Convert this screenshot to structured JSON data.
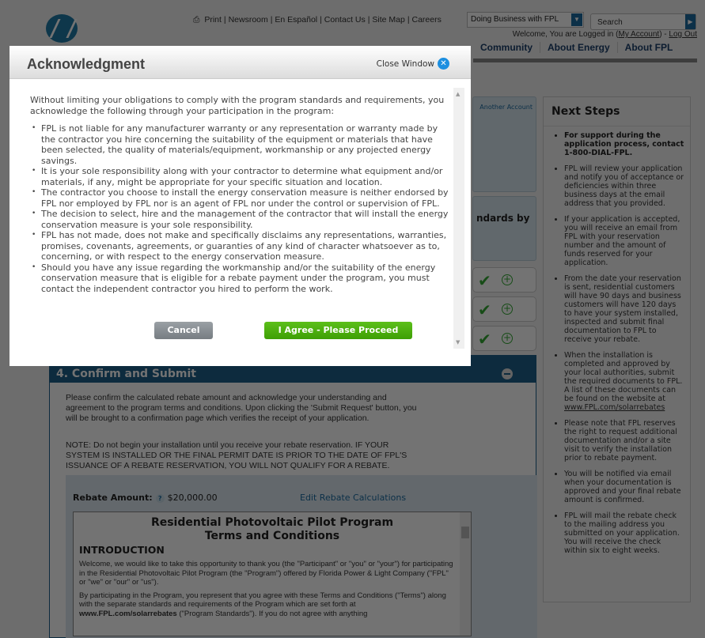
{
  "header": {
    "links": [
      "Print",
      "Newsroom",
      "En Español",
      "Contact Us",
      "Site Map",
      "Careers"
    ],
    "business_select": "Doing Business with FPL",
    "search_placeholder": "Search",
    "welcome": "Welcome, You are Logged in (",
    "my_account": "My Account",
    "sep": ") - ",
    "logout": "Log Out",
    "nav": [
      "Community",
      "About Energy",
      "About FPL"
    ]
  },
  "steps": {
    "another_account": "Another Account",
    "standards_by": "ndards by",
    "step4_title": "4. Confirm and Submit"
  },
  "confirm": {
    "paragraph": "Please confirm the calculated rebate amount and acknowledge your understanding and agreement to the program terms and conditions. Upon clicking the 'Submit Request' button, you will be brought to a confirmation page which verifies the receipt of your application.",
    "note": "NOTE: Do not begin your installation until you receive your rebate reservation. IF YOUR SYSTEM IS INSTALLED OR THE FINAL PERMIT DATE IS PRIOR TO THE DATE OF FPL'S ISSUANCE OF A REBATE RESERVATION, YOU WILL NOT QUALIFY FOR A REBATE.",
    "rebate_label": "Rebate Amount:",
    "help": "?",
    "rebate_amount": "$20,000.00",
    "edit_link": "Edit Rebate Calculations"
  },
  "terms": {
    "title1": "Residential Photovoltaic Pilot Program",
    "title2": "Terms and Conditions",
    "intro": "INTRODUCTION",
    "p1": "Welcome, we would like to take this opportunity to thank you (the \"Participant\" or \"you\" or \"your\") for participating in the Residential Photovoltaic Pilot Program (the \"Program\") offered by Florida Power & Light Company (\"FPL\" or \"we\" or \"our\" or \"us\").",
    "p2a": "By participating in the Program, you represent that you agree with these Terms and Conditions (\"Terms\") along with the separate standards and requirements of the Program which are set forth at ",
    "p2link": "www.FPL.com/solarrebates",
    "p2b": " (\"Program Standards\"). If you do not agree with anything"
  },
  "sidebar": {
    "title": "Next Steps",
    "items": [
      "For support during the application process, contact 1-800-DIAL-FPL.",
      "FPL will review your application and notify you of acceptance or deficiencies within three business days at the email address that you provided.",
      "If your application is accepted, you will receive an email from FPL with your reservation number and the amount of funds reserved for your application.",
      "From the date your reservation is sent, residential customers will have 90 days and business customers will have 120 days to have your system installed, inspected and submit final documentation to FPL to receive your rebate.",
      "When the installation is completed and approved by your local authorities, submit the required documents to FPL. A list of these documents can be found on the website at ",
      "Please note that FPL reserves the right to request additional documentation and/or a site visit to verify the installation prior to rebate payment.",
      "You will be notified via email when your documentation is approved and your final rebate amount is confirmed.",
      "FPL will mail the rebate check to the mailing address you submitted on your application. You will receive the check within six to eight weeks."
    ],
    "link": "www.FPL.com/solarrebates"
  },
  "modal": {
    "title": "Acknowledgment",
    "close": "Close Window",
    "intro": "Without limiting your obligations to comply with the program standards and requirements, you acknowledge the following through your participation in the program:",
    "items": [
      "FPL is not liable for any manufacturer warranty or any representation or warranty made by the contractor you hire concerning the suitability of the equipment or materials that have been selected, the quality of materials/equipment, workmanship or any projected energy savings.",
      "It is your sole responsibility along with your contractor to determine what equipment and/or materials, if any, might be appropriate for your specific situation and location.",
      "The contractor you choose to install the energy conservation measure is neither endorsed by FPL nor employed by FPL nor is an agent of FPL nor under the control or supervision of FPL.",
      "The decision to select, hire and the management of the contractor that will install the energy conservation measure is your sole responsibility.",
      "FPL has not made, does not make and specifically disclaims any representations, warranties, promises, covenants, agreements, or guaranties of any kind of character whatsoever as to, concerning, or with respect to the energy conservation measure.",
      "Should you have any issue regarding the workmanship and/or the suitability of the energy conservation measure that is eligible for a rebate payment under the program, you must contact the independent contractor you hired to perform the work."
    ],
    "cancel": "Cancel",
    "agree": "I Agree - Please Proceed"
  }
}
